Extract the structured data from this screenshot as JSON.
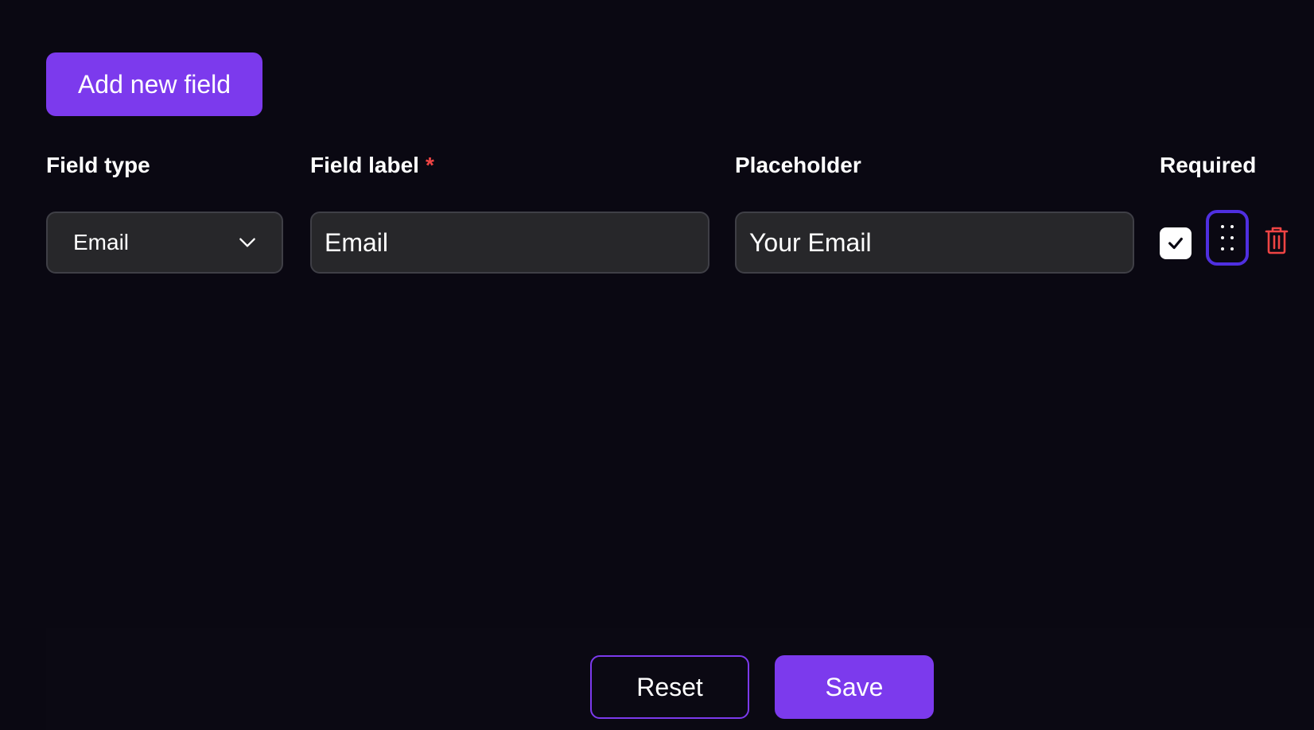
{
  "toolbar": {
    "add_label": "Add new field"
  },
  "columns": {
    "field_type": "Field type",
    "field_label": "Field label",
    "field_label_required_mark": "*",
    "placeholder": "Placeholder",
    "required": "Required"
  },
  "row": {
    "field_type_value": "Email",
    "field_label_value": "Email",
    "placeholder_value": "Your Email",
    "required_checked": true
  },
  "footer": {
    "reset_label": "Reset",
    "save_label": "Save"
  },
  "colors": {
    "accent": "#7c3aed",
    "focus_ring": "#4f2fe0",
    "danger": "#ef4444",
    "background": "#0a0812",
    "input_bg": "#27272a"
  },
  "icons": {
    "dropdown": "chevron-down-icon",
    "checkbox": "checkmark-icon",
    "drag": "drag-handle-icon",
    "delete": "trash-icon"
  }
}
